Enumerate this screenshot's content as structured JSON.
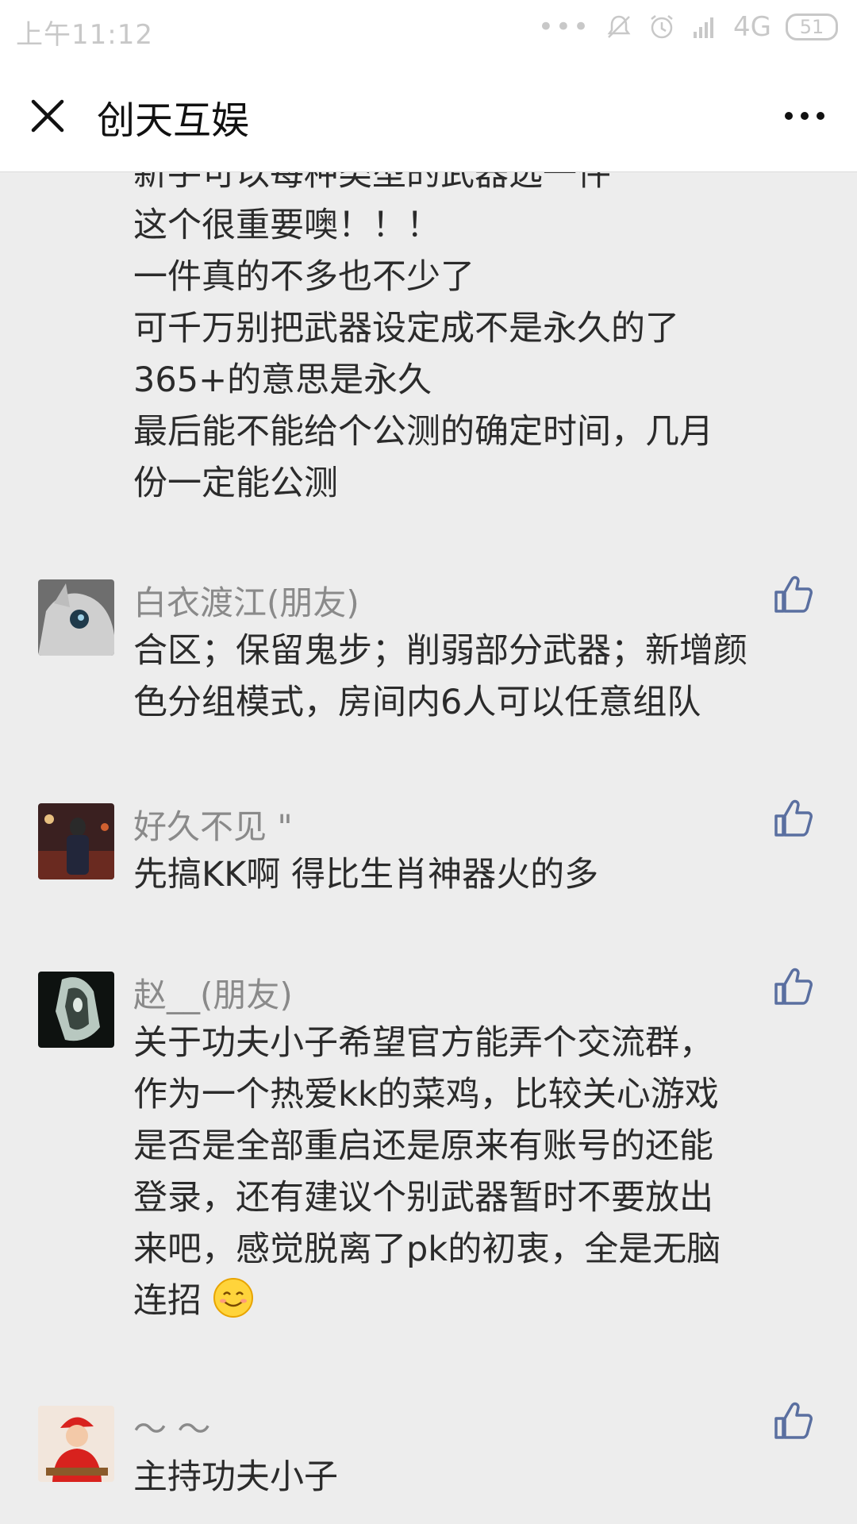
{
  "status_bar": {
    "time": "上午11:12",
    "dots": "•••",
    "network": "4G",
    "battery": "51"
  },
  "title_bar": {
    "title": "创天互娱"
  },
  "partial_comment": {
    "lines": [
      "新手可以每种类型的武器选一件",
      "这个很重要噢！！！",
      "一件真的不多也不少了",
      "可千万别把武器设定成不是永久的了",
      "365+的意思是永久",
      "最后能不能给个公测的确定时间，几月",
      "份一定能公测"
    ]
  },
  "comments": [
    {
      "name": "白衣渡江(朋友)",
      "lines": [
        "合区；保留鬼步；削弱部分武器；新增颜",
        "色分组模式，房间内6人可以任意组队"
      ],
      "avatar_icon": "owl-avatar-icon"
    },
    {
      "name": "好久不见 \"",
      "lines": [
        "先搞KK啊 得比生肖神器火的多"
      ],
      "avatar_icon": "person-night-avatar-icon"
    },
    {
      "name": "赵__(朋友)",
      "lines": [
        "关于功夫小子希望官方能弄个交流群，",
        "作为一个热爱kk的菜鸡，比较关心游戏",
        "是否是全部重启还是原来有账号的还能",
        "登录，还有建议个别武器暂时不要放出",
        "来吧，感觉脱离了pk的初衷，全是无脑",
        "连招"
      ],
      "avatar_icon": "dark-figure-avatar-icon"
    },
    {
      "name": "～ ～",
      "lines": [
        "主持功夫小子"
      ],
      "avatar_icon": "child-red-hat-avatar-icon"
    }
  ],
  "colors": {
    "background": "#ededed",
    "like_icon": "#5a6fa0",
    "name_text": "#8a8a8a"
  }
}
